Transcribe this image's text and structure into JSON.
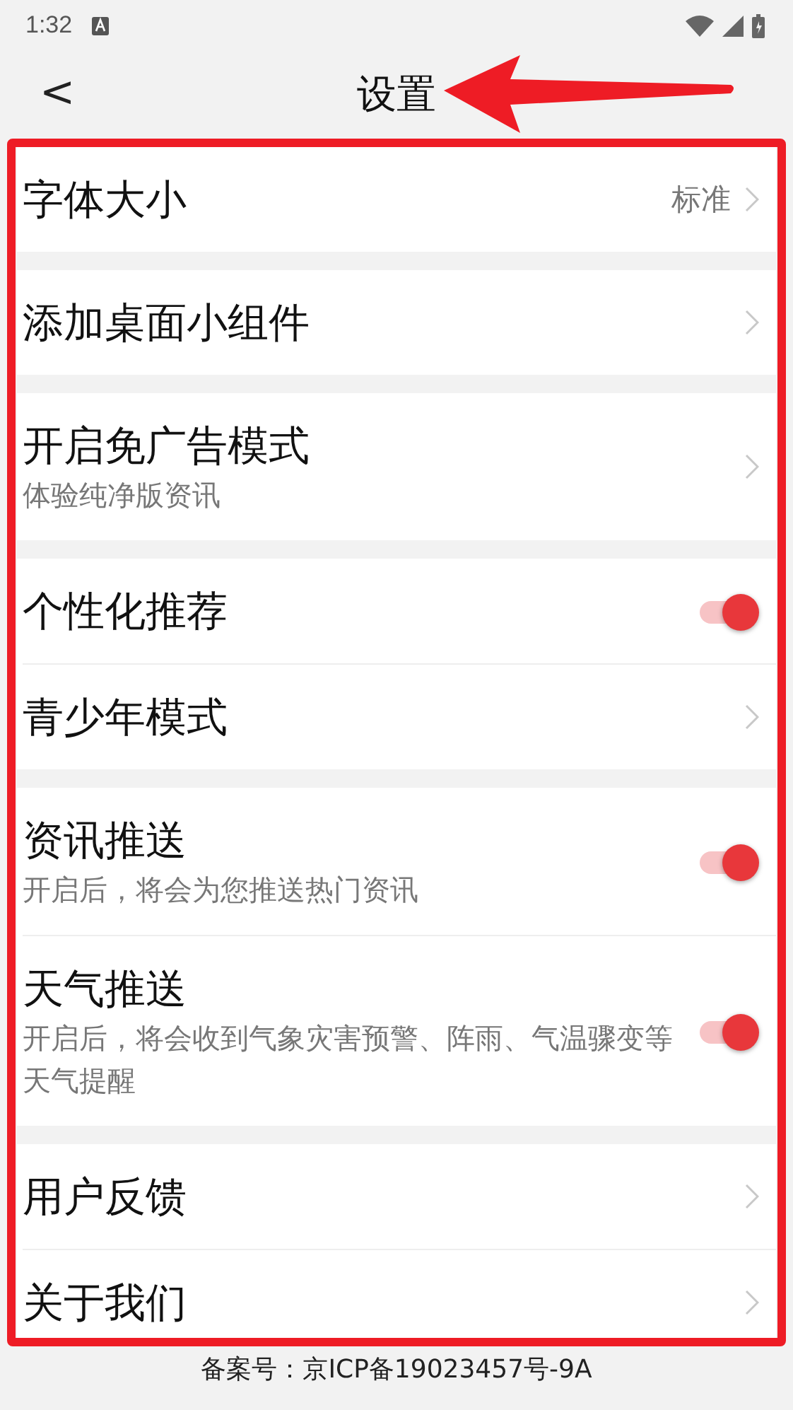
{
  "status_bar": {
    "time": "1:32"
  },
  "header": {
    "back": "<",
    "title": "设置"
  },
  "groups": [
    {
      "items": [
        {
          "kind": "link",
          "label": "字体大小",
          "value": "标准"
        }
      ]
    },
    {
      "items": [
        {
          "kind": "link",
          "label": "添加桌面小组件"
        }
      ]
    },
    {
      "items": [
        {
          "kind": "link",
          "label": "开启免广告模式",
          "subtitle": "体验纯净版资讯"
        }
      ]
    },
    {
      "items": [
        {
          "kind": "toggle",
          "label": "个性化推荐",
          "on": true
        },
        {
          "kind": "link",
          "label": "青少年模式"
        }
      ]
    },
    {
      "items": [
        {
          "kind": "toggle",
          "label": "资讯推送",
          "subtitle": "开启后，将会为您推送热门资讯",
          "on": true
        },
        {
          "kind": "toggle",
          "label": "天气推送",
          "subtitle": "开启后，将会收到气象灾害预警、阵雨、气温骤变等天气提醒",
          "on": true
        }
      ]
    },
    {
      "items": [
        {
          "kind": "link",
          "label": "用户反馈"
        },
        {
          "kind": "link",
          "label": "关于我们"
        }
      ]
    }
  ],
  "footer": "备案号：京ICP备19023457号-9A"
}
